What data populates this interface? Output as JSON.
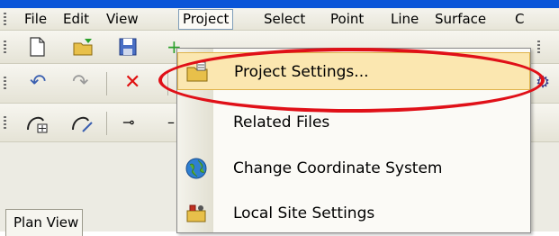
{
  "menubar": {
    "items": [
      "File",
      "Edit",
      "View",
      "Project",
      "Select",
      "Point",
      "Line",
      "Surface",
      "C"
    ]
  },
  "dropdown": {
    "items": [
      {
        "label": "Project Settings...",
        "icon": "folder-settings-icon"
      },
      {
        "label": "Related Files",
        "icon": ""
      },
      {
        "label": "Change Coordinate System",
        "icon": "globe-icon"
      },
      {
        "label": "Local Site Settings",
        "icon": "site-settings-icon"
      }
    ]
  },
  "tabs": {
    "plan_view": "Plan View"
  },
  "colors": {
    "accent_title": "#0a55d8",
    "highlight_ellipse": "#e01018",
    "menu_hover": "#fbe7b0"
  }
}
